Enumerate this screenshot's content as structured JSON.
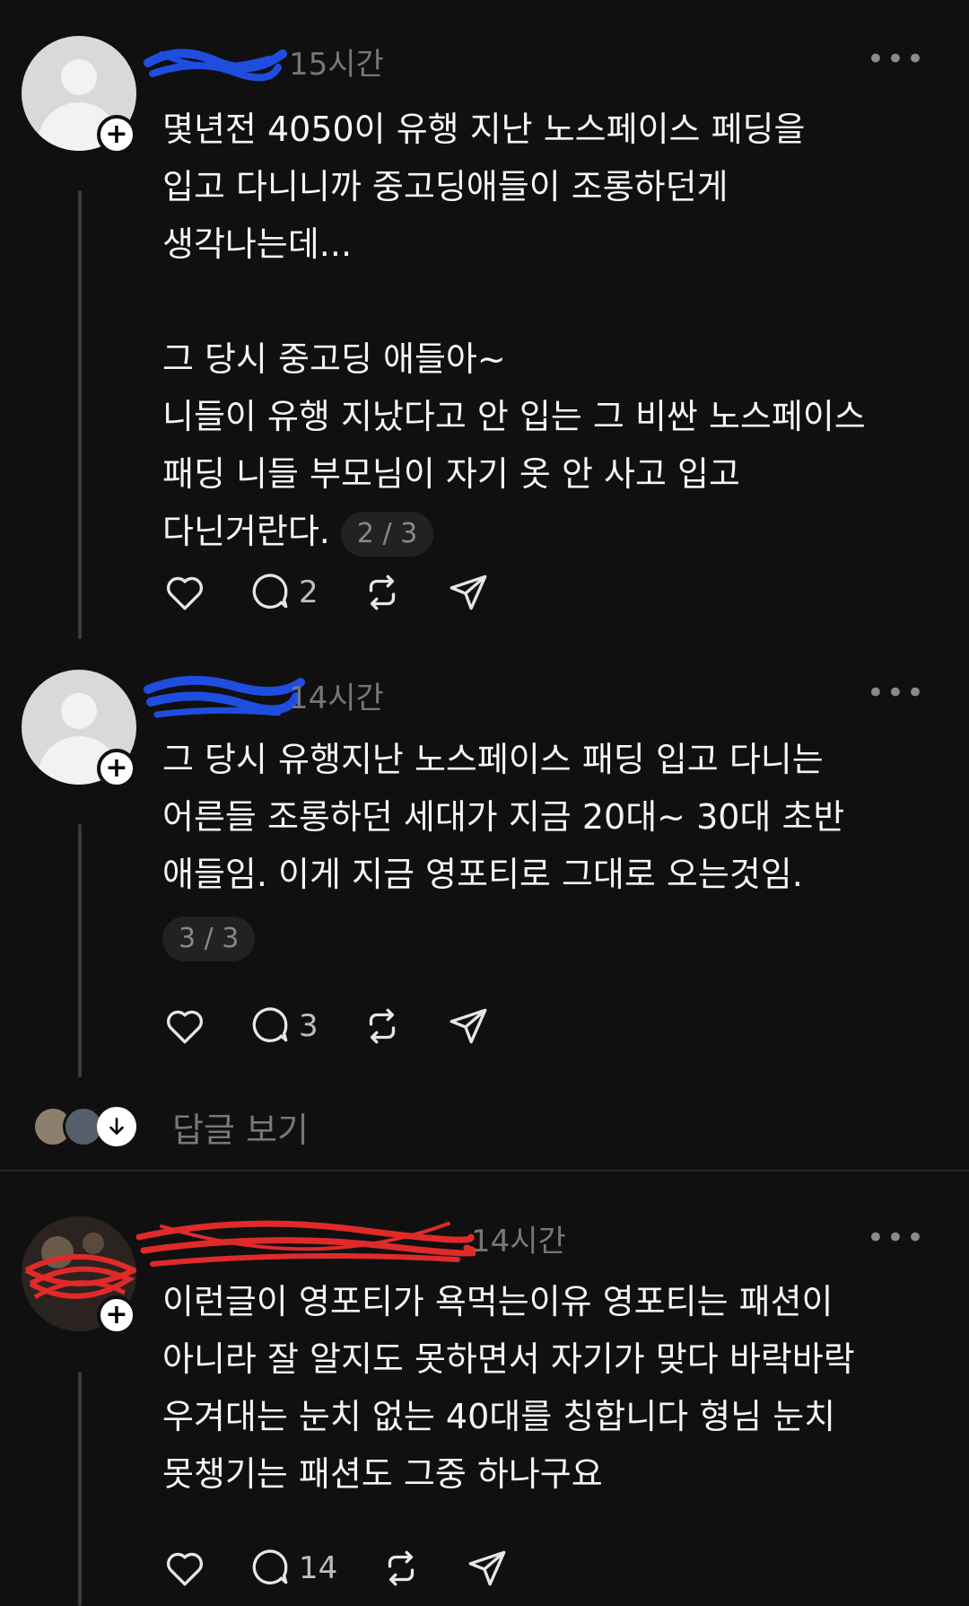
{
  "posts": [
    {
      "time": "15시간",
      "more": "•••",
      "text": "몇년전 4050이 유행 지난 노스페이스 페딩을\n입고 다니니까 중고딩애들이 조롱하던게\n생각나는데...\n\n그 당시 중고딩 애들아~\n니들이 유행 지났다고 안 입는 그 비싼 노스페이스\n패딩 니들 부모님이 자기 옷 안 사고 입고\n다닌거란다.",
      "pager": "2 / 3",
      "like_icon": "heart-icon",
      "reply_count": "2"
    },
    {
      "time": "14시간",
      "more": "•••",
      "text": "그 당시 유행지난 노스페이스 패딩 입고 다니는\n어른들 조롱하던 세대가 지금 20대~ 30대 초반\n애들임. 이게 지금 영포티로 그대로 오는것임.",
      "pager": "3 / 3",
      "like_icon": "heart-icon",
      "reply_count": "3"
    },
    {
      "time": "14시간",
      "more": "•••",
      "text": "이런글이 영포티가 욕먹는이유 영포티는 패션이\n아니라 잘 알지도 못하면서 자기가 맞다 바락바락\n우겨대는 눈치 없는 40대를 칭합니다 형님 눈치\n못챙기는 패션도 그중 하나구요",
      "like_icon": "heart-icon",
      "reply_count": "14"
    }
  ],
  "replies_link": "답글 보기",
  "colors": {
    "background": "#101010",
    "text": "#f3f5f7",
    "muted": "#777777",
    "scribble_blue": "#1f4de0",
    "scribble_red": "#e02a2a"
  }
}
